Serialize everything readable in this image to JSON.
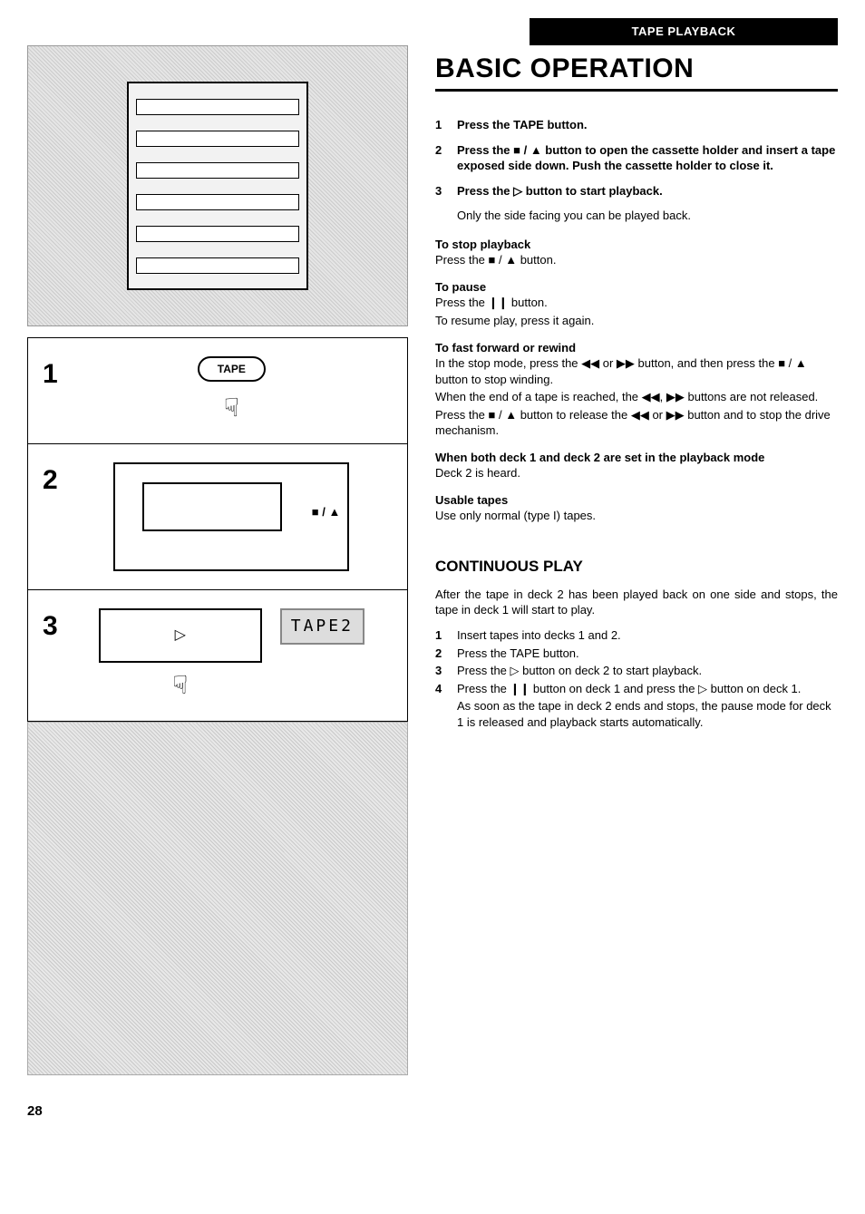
{
  "header": {
    "section_bar": "TAPE PLAYBACK",
    "title": "BASIC OPERATION"
  },
  "steps": [
    {
      "num": "1",
      "text": "Press the TAPE button."
    },
    {
      "num": "2",
      "text": "Press the ■ / ▲ button to open the cassette holder and insert a tape exposed side down. Push the cassette holder to close it."
    },
    {
      "num": "3",
      "text": "Press the ▷ button to start playback.",
      "sub": "Only the side facing you can be played back."
    }
  ],
  "paras": {
    "stop": {
      "title": "To stop playback",
      "body": "Press the ■ / ▲ button."
    },
    "pause": {
      "title": "To pause",
      "body1": "Press the ❙❙ button.",
      "body2": "To resume play, press it again."
    },
    "ff": {
      "title": "To fast forward or rewind",
      "body1": "In the stop mode, press the ◀◀ or ▶▶ button, and then press the ■ / ▲ button to stop winding.",
      "body2": "When the end of a tape is reached, the ◀◀, ▶▶ buttons are not released.",
      "body3": "Press the ■ / ▲ button to release the ◀◀ or ▶▶ button and to stop the drive mechanism."
    },
    "both": {
      "title": "When both deck 1 and deck 2 are set in the playback mode",
      "body": "Deck 2 is heard."
    },
    "usable": {
      "title": "Usable tapes",
      "body": "Use only normal (type I) tapes."
    }
  },
  "continuous": {
    "heading": "CONTINUOUS PLAY",
    "intro": "After the tape in deck 2 has been played back on one side and stops, the tape in deck 1 will start to play.",
    "list": [
      {
        "n": "1",
        "t": "Insert tapes into decks 1 and 2."
      },
      {
        "n": "2",
        "t": "Press the TAPE button."
      },
      {
        "n": "3",
        "t": "Press the ▷ button on deck 2 to start playback."
      },
      {
        "n": "4",
        "t": "Press the ❙❙ button on deck 1 and press the ▷ button on deck 1.",
        "cont": "As soon as the tape in deck 2 ends and stops, the pause mode for deck 1 is released and playback starts automatically."
      }
    ]
  },
  "left_panels": {
    "p1_num": "1",
    "p1_btn": "TAPE",
    "p2_num": "2",
    "p2_label": "■ / ▲",
    "p3_num": "3",
    "p3_play": "▷",
    "p3_lcd": "TAPE2"
  },
  "page_number": "28"
}
